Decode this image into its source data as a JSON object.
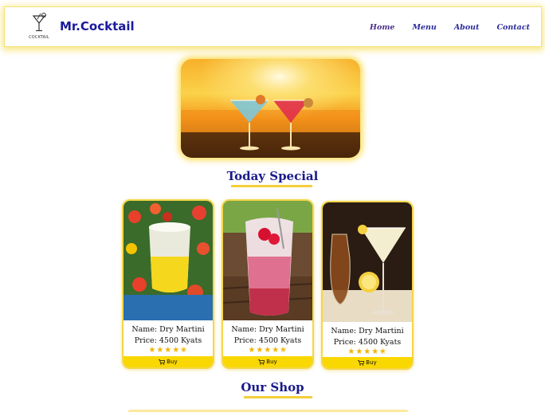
{
  "header": {
    "logo_text": "COCKTAIL",
    "brand": "Mr.Cocktail",
    "nav": [
      "Home",
      "Menu",
      "About",
      "Contact"
    ]
  },
  "sections": {
    "special_title": "Today Special",
    "shop_title": "Our Shop"
  },
  "cards": [
    {
      "name": "Name: Dry Martini",
      "price": "Price: 4500 Kyats",
      "rating": "★★★★✬",
      "buy": "Buy"
    },
    {
      "name": "Name: Dry Martini",
      "price": "Price: 4500 Kyats",
      "rating": "★★★★✬",
      "buy": "Buy"
    },
    {
      "name": "Name: Dry Martini",
      "price": "Price: 4500 Kyats",
      "rating": "★★★★✬",
      "buy": "Buy"
    }
  ],
  "colors": {
    "brand_blue": "#1a1a9c",
    "accent_yellow": "#f9d700",
    "glow_yellow": "#f5dc5a"
  }
}
